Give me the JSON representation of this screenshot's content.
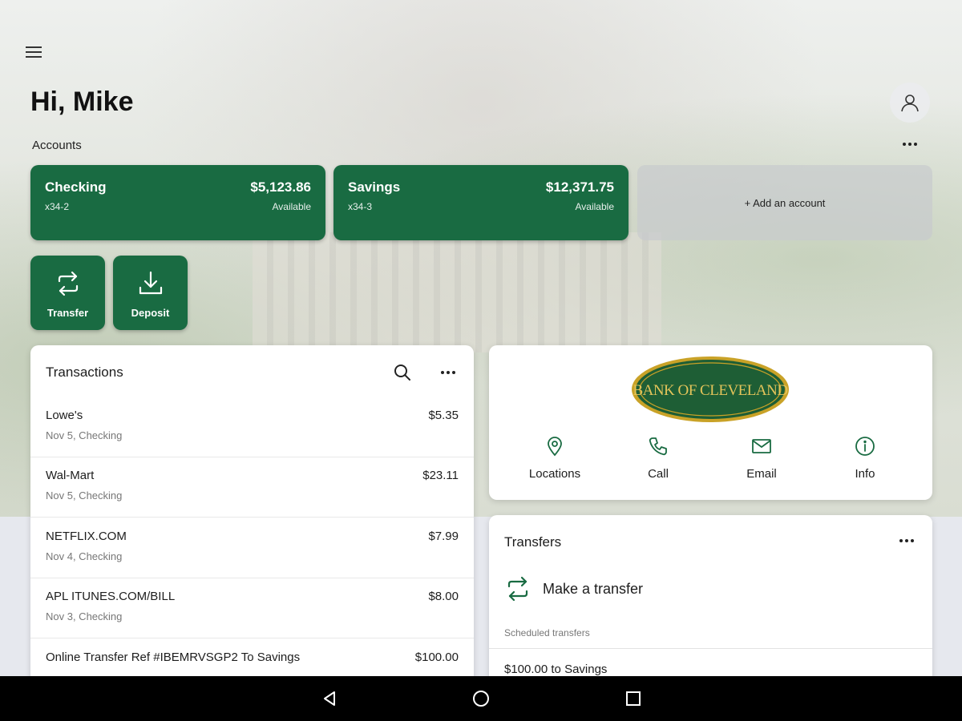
{
  "header": {
    "greeting": "Hi, Mike",
    "menu_icon": "hamburger-menu-icon",
    "profile_icon": "user-profile-icon"
  },
  "accounts": {
    "label": "Accounts",
    "more_icon": "more-dots-icon",
    "items": [
      {
        "name": "Checking",
        "number": "x34-2",
        "balance": "$5,123.86",
        "balance_label": "Available"
      },
      {
        "name": "Savings",
        "number": "x34-3",
        "balance": "$12,371.75",
        "balance_label": "Available"
      }
    ],
    "add_label": "+ Add an account"
  },
  "actions": [
    {
      "label": "Transfer",
      "icon": "transfer-arrows-icon"
    },
    {
      "label": "Deposit",
      "icon": "deposit-download-icon"
    }
  ],
  "transactions": {
    "title": "Transactions",
    "rows": [
      {
        "description": "Lowe's",
        "meta": "Nov 5, Checking",
        "amount": "$5.35"
      },
      {
        "description": "Wal-Mart",
        "meta": "Nov 5, Checking",
        "amount": "$23.11"
      },
      {
        "description": "NETFLIX.COM",
        "meta": "Nov 4, Checking",
        "amount": "$7.99"
      },
      {
        "description": "APL ITUNES.COM/BILL",
        "meta": "Nov 3, Checking",
        "amount": "$8.00"
      },
      {
        "description": "Online Transfer Ref #IBEMRVSGP2 To Savings",
        "meta": "",
        "amount": "$100.00"
      }
    ]
  },
  "bank": {
    "logo_text": "BANK OF CLEVELAND",
    "links": [
      {
        "label": "Locations",
        "icon": "location-pin-icon"
      },
      {
        "label": "Call",
        "icon": "phone-icon"
      },
      {
        "label": "Email",
        "icon": "envelope-icon"
      },
      {
        "label": "Info",
        "icon": "info-circle-icon"
      }
    ]
  },
  "transfers": {
    "title": "Transfers",
    "make_label": "Make a transfer",
    "scheduled_label": "Scheduled transfers",
    "scheduled_items": [
      "$100.00 to Savings"
    ]
  },
  "colors": {
    "brand_green": "#196b42",
    "logo_gold": "#c9a227"
  }
}
